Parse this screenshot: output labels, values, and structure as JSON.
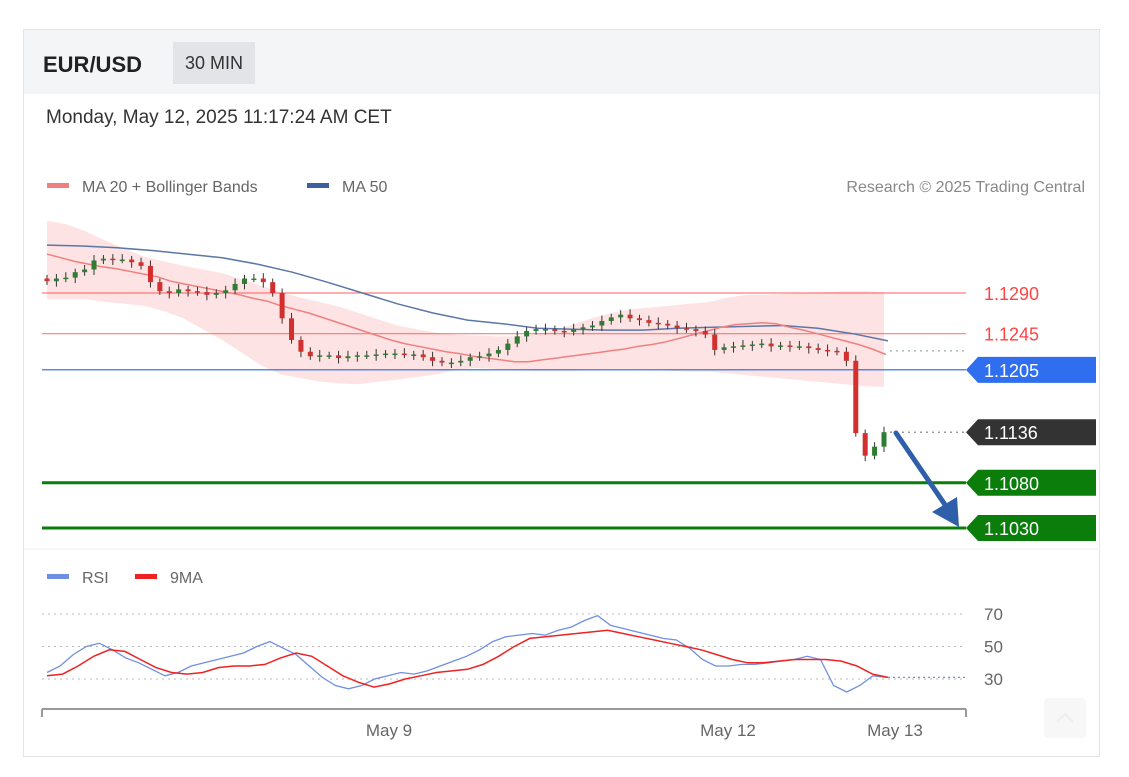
{
  "header": {
    "symbol": "EUR/USD",
    "timeframe": "30 MIN",
    "timestamp": "Monday, May 12, 2025 11:17:24 AM CET"
  },
  "legend": {
    "ma20": "MA 20 + Bollinger Bands",
    "ma50": "MA 50",
    "credit": "Research © 2025 Trading Central"
  },
  "rsi_legend": {
    "rsi": "RSI",
    "ma9": "9MA"
  },
  "colors": {
    "up_candle": "#2e7d32",
    "down_candle": "#d32f2f",
    "ma20": "#f08080",
    "bollinger_fill": "#fde0e0",
    "ma50": "#5b77a6",
    "pivot": "#2266ee",
    "support": "#0a7d0a",
    "resistance": "#ff4444",
    "current": "#333333",
    "arrow": "#2f5fa8",
    "rsi_line": "#6f8fe0",
    "rsi_ma": "#ee2222"
  },
  "chart_data": {
    "type": "candlestick",
    "y_range": [
      1.098,
      1.1375
    ],
    "levels": [
      {
        "value": 1.129,
        "label": "1.1290",
        "kind": "resistance"
      },
      {
        "value": 1.1245,
        "label": "1.1245",
        "kind": "resistance"
      },
      {
        "value": 1.1205,
        "label": "1.1205",
        "kind": "pivot"
      },
      {
        "value": 1.1136,
        "label": "1.1136",
        "kind": "current"
      },
      {
        "value": 1.108,
        "label": "1.1080",
        "kind": "support"
      },
      {
        "value": 1.103,
        "label": "1.1030",
        "kind": "support"
      }
    ],
    "closes": [
      1.1303,
      1.1306,
      1.1307,
      1.1313,
      1.1316,
      1.1326,
      1.1328,
      1.1327,
      1.1327,
      1.1324,
      1.132,
      1.1302,
      1.1292,
      1.129,
      1.1294,
      1.1292,
      1.1291,
      1.1288,
      1.129,
      1.1293,
      1.13,
      1.1306,
      1.1306,
      1.1302,
      1.129,
      1.1262,
      1.1238,
      1.1225,
      1.122,
      1.1221,
      1.1221,
      1.1218,
      1.122,
      1.1221,
      1.1221,
      1.1222,
      1.1223,
      1.1223,
      1.1222,
      1.1222,
      1.1219,
      1.1215,
      1.1213,
      1.1213,
      1.1215,
      1.1219,
      1.122,
      1.1223,
      1.1227,
      1.1234,
      1.1242,
      1.1248,
      1.125,
      1.125,
      1.1248,
      1.1247,
      1.125,
      1.1252,
      1.1254,
      1.1259,
      1.1263,
      1.1266,
      1.1262,
      1.126,
      1.1257,
      1.1256,
      1.1254,
      1.1251,
      1.125,
      1.1248,
      1.1244,
      1.1227,
      1.123,
      1.1231,
      1.1232,
      1.1233,
      1.1234,
      1.1231,
      1.1232,
      1.1231,
      1.1231,
      1.1229,
      1.1227,
      1.1226,
      1.1225,
      1.1215,
      1.1135,
      1.111,
      1.112,
      1.1136
    ],
    "ma20": [
      1.1333,
      1.1329,
      1.1325,
      1.1322,
      1.1319,
      1.1317,
      1.1314,
      1.1311,
      1.1308,
      1.1303,
      1.13,
      1.1297,
      1.1294,
      1.1291,
      1.1288,
      1.1284,
      1.1281,
      1.1276,
      1.1272,
      1.1268,
      1.1263,
      1.1258,
      1.1253,
      1.1248,
      1.1243,
      1.1238,
      1.1234,
      1.1231,
      1.1228,
      1.1225,
      1.1223,
      1.122,
      1.1218,
      1.1216,
      1.1214,
      1.1214,
      1.1216,
      1.1218,
      1.122,
      1.1222,
      1.1224,
      1.1226,
      1.1228,
      1.1231,
      1.1233,
      1.1236,
      1.124,
      1.1244,
      1.1248,
      1.1252,
      1.1255,
      1.1256,
      1.1257,
      1.1256,
      1.1252,
      1.1249,
      1.1245,
      1.1241,
      1.1237,
      1.1233,
      1.1228,
      1.1222
    ],
    "ma20_x": [
      45,
      60,
      75,
      90,
      105,
      120,
      135,
      150,
      165,
      180,
      195,
      210,
      225,
      240,
      255,
      270,
      285,
      300,
      315,
      330,
      345,
      360,
      375,
      390,
      405,
      420,
      435,
      450,
      465,
      480,
      495,
      510,
      525,
      540,
      555,
      570,
      585,
      600,
      615,
      630,
      645,
      660,
      675,
      690,
      705,
      720,
      735,
      750,
      765,
      780,
      795,
      810,
      825,
      840,
      855,
      870,
      885,
      870,
      875,
      880,
      884,
      887
    ],
    "bb_upper": [
      1.137,
      1.1366,
      1.1358,
      1.1348,
      1.1339,
      1.133,
      1.1325,
      1.132,
      1.1316,
      1.1312,
      1.1305,
      1.1298,
      1.1291,
      1.1285,
      1.128,
      1.1275,
      1.1268,
      1.1261,
      1.1254,
      1.125,
      1.1246,
      1.1244,
      1.1243,
      1.1242,
      1.1242,
      1.1244,
      1.1248,
      1.1255,
      1.1262,
      1.1268,
      1.1272,
      1.1274,
      1.1276,
      1.1278,
      1.128,
      1.1285,
      1.1288,
      1.1288,
      1.1289,
      1.129,
      1.1291,
      1.1292,
      1.1292,
      1.1291
    ],
    "bb_lower": [
      1.1283,
      1.1283,
      1.1283,
      1.128,
      1.1278,
      1.1276,
      1.127,
      1.1262,
      1.125,
      1.1238,
      1.1224,
      1.121,
      1.12,
      1.1196,
      1.1192,
      1.119,
      1.1189,
      1.1192,
      1.1194,
      1.1197,
      1.12,
      1.1205,
      1.1207,
      1.1206,
      1.1205,
      1.1204,
      1.1204,
      1.1204,
      1.1205,
      1.1206,
      1.1206,
      1.1205,
      1.1204,
      1.1203,
      1.1203,
      1.1201,
      1.1199,
      1.1197,
      1.1195,
      1.1193,
      1.1191,
      1.1189,
      1.1187,
      1.1186
    ],
    "ma50": [
      1.1343,
      1.1342,
      1.134,
      1.1337,
      1.1333,
      1.1329,
      1.1322,
      1.1313,
      1.1302,
      1.129,
      1.1278,
      1.1268,
      1.126,
      1.1256,
      1.1251,
      1.125,
      1.1249,
      1.1249,
      1.1251,
      1.1252,
      1.1253,
      1.1254,
      1.1251,
      1.1245,
      1.1237
    ],
    "rsi": {
      "y_range": [
        15,
        80
      ],
      "levels": [
        70,
        50,
        30
      ],
      "rsi_values": [
        34,
        38,
        45,
        50,
        52,
        48,
        43,
        40,
        36,
        32,
        34,
        38,
        40,
        42,
        44,
        46,
        50,
        53,
        49,
        45,
        38,
        31,
        26,
        24,
        26,
        30,
        32,
        34,
        33,
        35,
        38,
        41,
        44,
        48,
        53,
        56,
        57,
        58,
        57,
        60,
        62,
        66,
        69,
        63,
        61,
        59,
        57,
        55,
        54,
        49,
        42,
        38,
        38,
        39,
        39,
        40,
        41,
        42,
        44,
        42,
        26,
        22,
        26,
        32,
        31
      ],
      "ma9_values": [
        32,
        33,
        38,
        44,
        48,
        47,
        42,
        37,
        34,
        33,
        34,
        37,
        38,
        38,
        39,
        43,
        46,
        44,
        38,
        32,
        28,
        25,
        27,
        30,
        32,
        34,
        35,
        36,
        39,
        44,
        50,
        55,
        56,
        57,
        58,
        59,
        60,
        58,
        56,
        54,
        52,
        50,
        48,
        45,
        42,
        40,
        40,
        41,
        42,
        42,
        42,
        41,
        38,
        33,
        31
      ]
    },
    "x_labels": [
      "May 9",
      "May 12",
      "May 13"
    ]
  }
}
